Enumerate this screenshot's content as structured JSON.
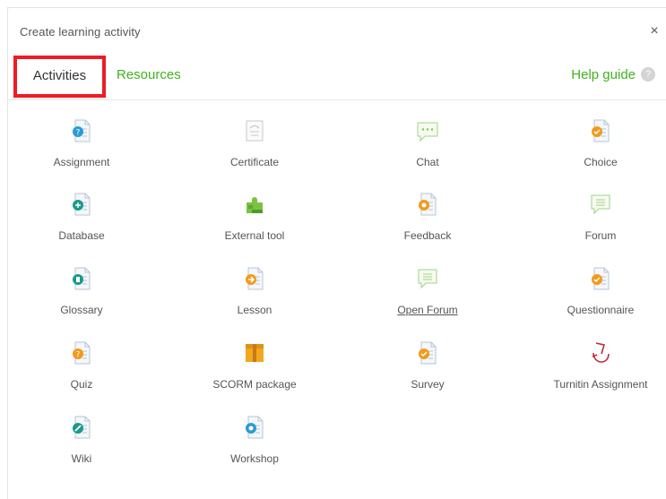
{
  "dialog": {
    "title": "Create learning activity",
    "close_glyph": "×"
  },
  "tabs": {
    "activities": "Activities",
    "resources": "Resources",
    "help_guide": "Help guide",
    "help_glyph": "?"
  },
  "colors": {
    "accent_green": "#3fb31e",
    "highlight_red": "#ee1c24",
    "doc_blue": "#2a9bd6",
    "doc_teal": "#1a9a8c",
    "doc_orange": "#f29a1c"
  },
  "activities": [
    {
      "label": "Assignment",
      "icon": "assignment-icon"
    },
    {
      "label": "Certificate",
      "icon": "certificate-icon"
    },
    {
      "label": "Chat",
      "icon": "chat-icon"
    },
    {
      "label": "Choice",
      "icon": "choice-icon"
    },
    {
      "label": "Database",
      "icon": "database-icon"
    },
    {
      "label": "External tool",
      "icon": "external-tool-icon"
    },
    {
      "label": "Feedback",
      "icon": "feedback-icon"
    },
    {
      "label": "Forum",
      "icon": "forum-icon"
    },
    {
      "label": "Glossary",
      "icon": "glossary-icon"
    },
    {
      "label": "Lesson",
      "icon": "lesson-icon"
    },
    {
      "label": "Open Forum",
      "icon": "open-forum-icon"
    },
    {
      "label": "Questionnaire",
      "icon": "questionnaire-icon"
    },
    {
      "label": "Quiz",
      "icon": "quiz-icon"
    },
    {
      "label": "SCORM package",
      "icon": "scorm-package-icon"
    },
    {
      "label": "Survey",
      "icon": "survey-icon"
    },
    {
      "label": "Turnitin Assignment",
      "icon": "turnitin-icon"
    },
    {
      "label": "Wiki",
      "icon": "wiki-icon"
    },
    {
      "label": "Workshop",
      "icon": "workshop-icon"
    }
  ]
}
